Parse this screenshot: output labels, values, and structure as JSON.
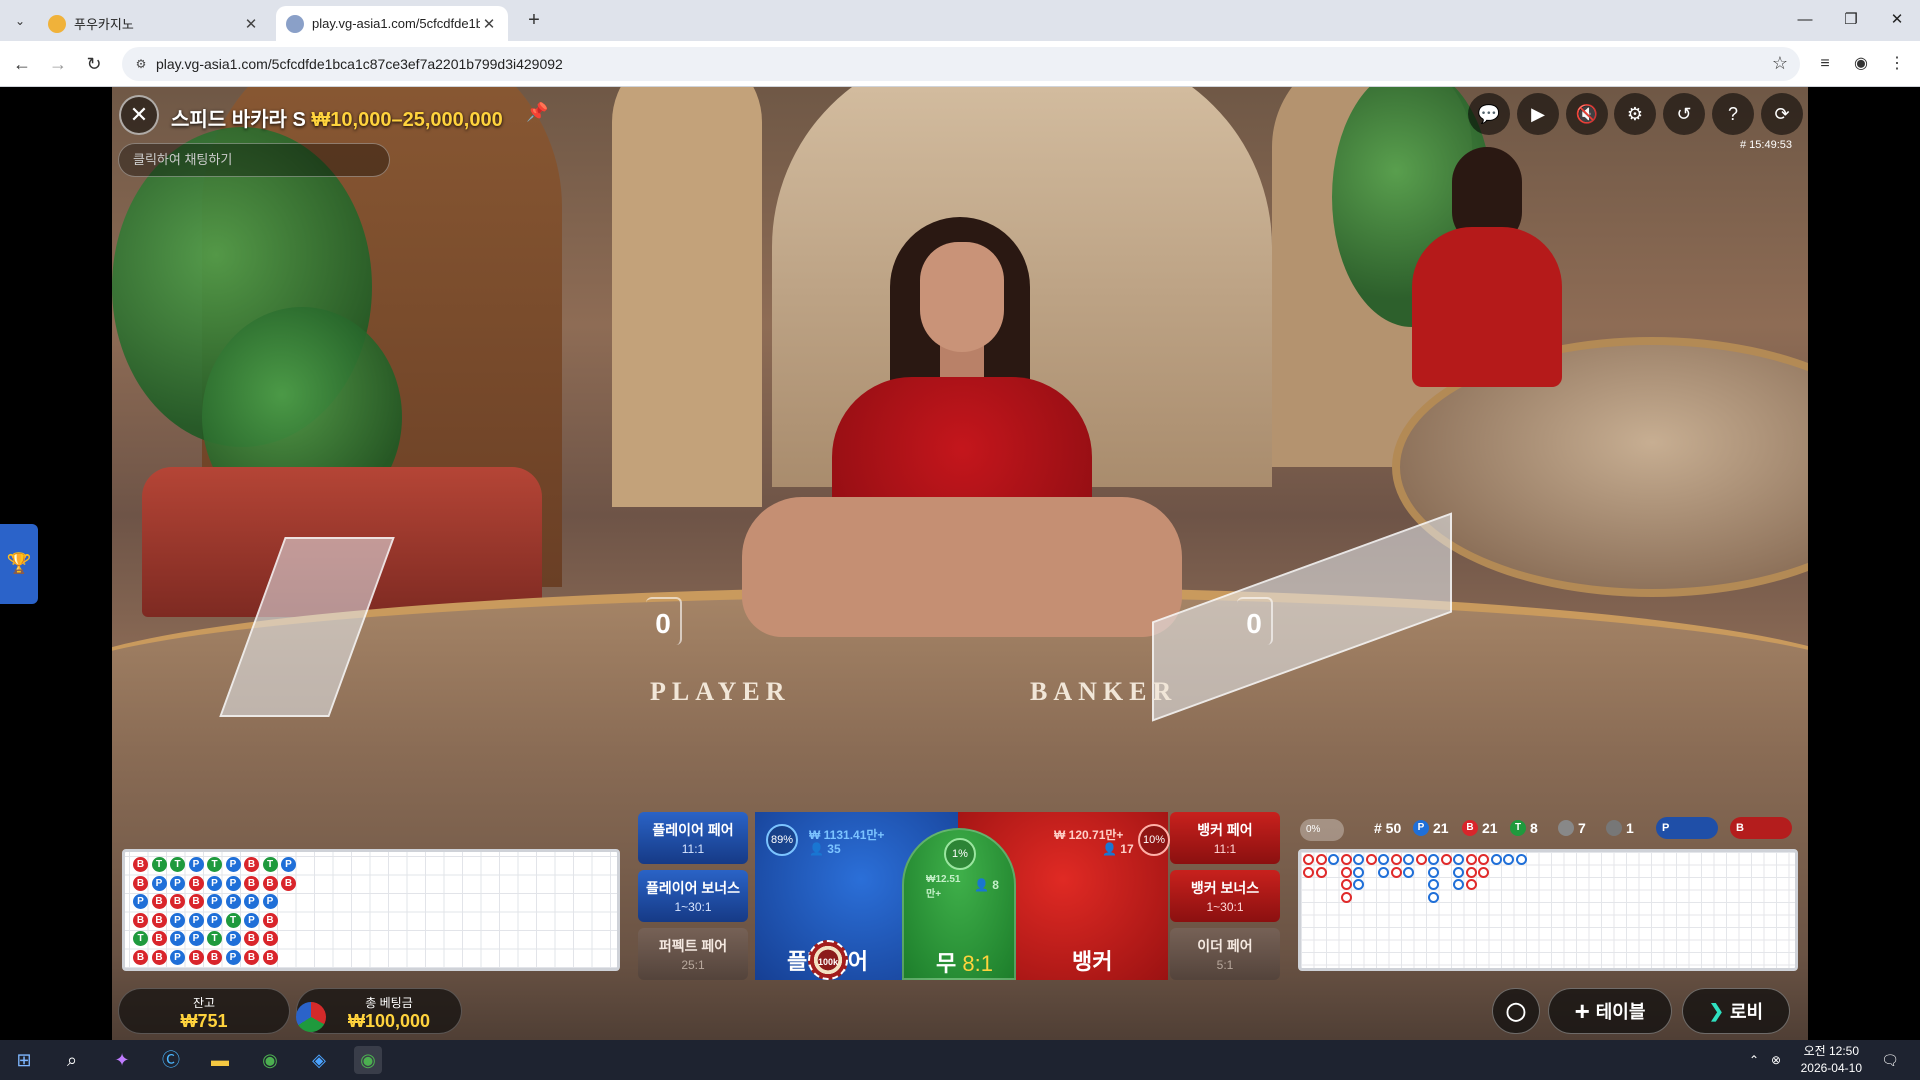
{
  "browser": {
    "tabs": [
      {
        "title": "푸우카지노",
        "active": false
      },
      {
        "title": "play.vg-asia1.com/5cfcdfde1b",
        "active": true
      }
    ],
    "url": "play.vg-asia1.com/5cfcdfde1bca1c87ce3ef7a2201b799d3i429092"
  },
  "game": {
    "name": "스피드 바카라 S",
    "limit": "₩10,000–25,000,000",
    "chat_placeholder": "클릭하여 채팅하기",
    "round_id": "# 15:49:53",
    "table_words": {
      "player": "PLAYER",
      "banker": "BANKER"
    },
    "scores": {
      "player": "0",
      "banker": "0"
    },
    "hud_icons": [
      "chat-icon",
      "video-icon",
      "mute-icon",
      "settings-icon",
      "history-icon",
      "help-icon",
      "fullscreen-icon"
    ]
  },
  "bets": {
    "player_pair": {
      "label": "플레이어 페어",
      "odds": "11:1"
    },
    "player_bonus": {
      "label": "플레이어 보너스",
      "odds": "1~30:1"
    },
    "perfect_pair": {
      "label": "퍼펙트 페어",
      "odds": "25:1"
    },
    "banker_pair": {
      "label": "뱅커 페어",
      "odds": "11:1"
    },
    "banker_bonus": {
      "label": "뱅커 보너스",
      "odds": "1~30:1"
    },
    "either_pair": {
      "label": "이더 페어",
      "odds": "5:1"
    },
    "player": {
      "label": "플레이어",
      "pct": "89%",
      "amount": "₩ 1131.41만+",
      "players": "35",
      "chip": "100k"
    },
    "tie": {
      "label": "무",
      "odds": "8:1",
      "pct": "1%",
      "amount": "₩12.51만+",
      "players": "8"
    },
    "banker": {
      "label": "뱅커",
      "pct": "10%",
      "amount": "₩ 120.71만+",
      "players": "17"
    }
  },
  "stats": {
    "toggle": "0%",
    "rounds": "# 50",
    "player": "21",
    "banker": "21",
    "tie": "8",
    "player_pair": "7",
    "banker_pair": "1",
    "pred_player": "P",
    "pred_banker": "B"
  },
  "bead_road": [
    [
      "B",
      "T",
      "T",
      "P",
      "T",
      "P",
      "B",
      "T",
      "P"
    ],
    [
      "B",
      "P",
      "P",
      "B",
      "P",
      "P",
      "B",
      "B",
      "B"
    ],
    [
      "P",
      "B",
      "B",
      "B",
      "P",
      "P",
      "P",
      "P"
    ],
    [
      "B",
      "B",
      "P",
      "P",
      "P",
      "T",
      "P",
      "B"
    ],
    [
      "T",
      "B",
      "P",
      "P",
      "T",
      "P",
      "B",
      "B"
    ],
    [
      "B",
      "B",
      "P",
      "B",
      "B",
      "P",
      "B",
      "B"
    ]
  ],
  "footer": {
    "balance_label": "잔고",
    "balance": "₩751",
    "total_bet_label": "총 베팅금",
    "total_bet": "₩100,000",
    "table_btn": "테이블",
    "lobby_btn": "로비"
  },
  "taskbar": {
    "time": "오전 12:50",
    "date": "2026-04-10"
  },
  "colors": {
    "accent_gold": "#ffd33d",
    "player_blue": "#1f6fd8",
    "banker_red": "#d9252b",
    "tie_green": "#1f9a3d"
  }
}
